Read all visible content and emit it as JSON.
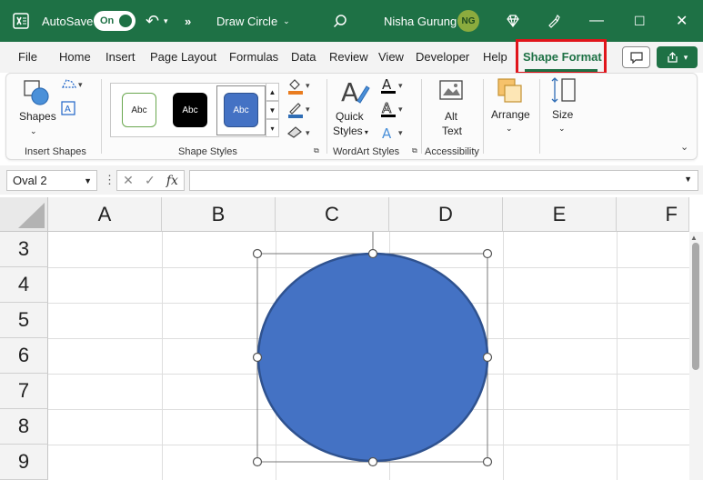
{
  "titlebar": {
    "autosave_label": "AutoSave",
    "autosave_state": "On",
    "doc_title": "Draw Circle",
    "user_name": "Nisha Gurung",
    "user_initials": "NG",
    "bg_color": "#1e7145"
  },
  "tabs": [
    {
      "label": "File"
    },
    {
      "label": "Home"
    },
    {
      "label": "Insert"
    },
    {
      "label": "Page Layout"
    },
    {
      "label": "Formulas"
    },
    {
      "label": "Data"
    },
    {
      "label": "Review"
    },
    {
      "label": "View"
    },
    {
      "label": "Developer"
    },
    {
      "label": "Help"
    },
    {
      "label": "Shape Format"
    }
  ],
  "active_tab": "Shape Format",
  "ribbon": {
    "insert_shapes": {
      "shapes_label": "Shapes",
      "group_label": "Insert Shapes"
    },
    "shape_styles": {
      "swatches": [
        {
          "label": "Abc"
        },
        {
          "label": "Abc"
        },
        {
          "label": "Abc"
        }
      ],
      "group_label": "Shape Styles"
    },
    "wordart": {
      "quick_styles_label_1": "Quick",
      "quick_styles_label_2": "Styles",
      "group_label": "WordArt Styles"
    },
    "accessibility": {
      "alt_text_label_1": "Alt",
      "alt_text_label_2": "Text",
      "group_label": "Accessibility"
    },
    "arrange": {
      "label": "Arrange"
    },
    "size": {
      "label": "Size"
    }
  },
  "formula_bar": {
    "name_box_value": "Oval 2",
    "formula_value": ""
  },
  "grid": {
    "columns": [
      "A",
      "B",
      "C",
      "D",
      "E",
      "F"
    ],
    "rows": [
      "3",
      "4",
      "5",
      "6",
      "7",
      "8",
      "9"
    ]
  },
  "shape": {
    "name": "Oval 2",
    "fill": "#4472c4",
    "outline": "#2f528f"
  }
}
